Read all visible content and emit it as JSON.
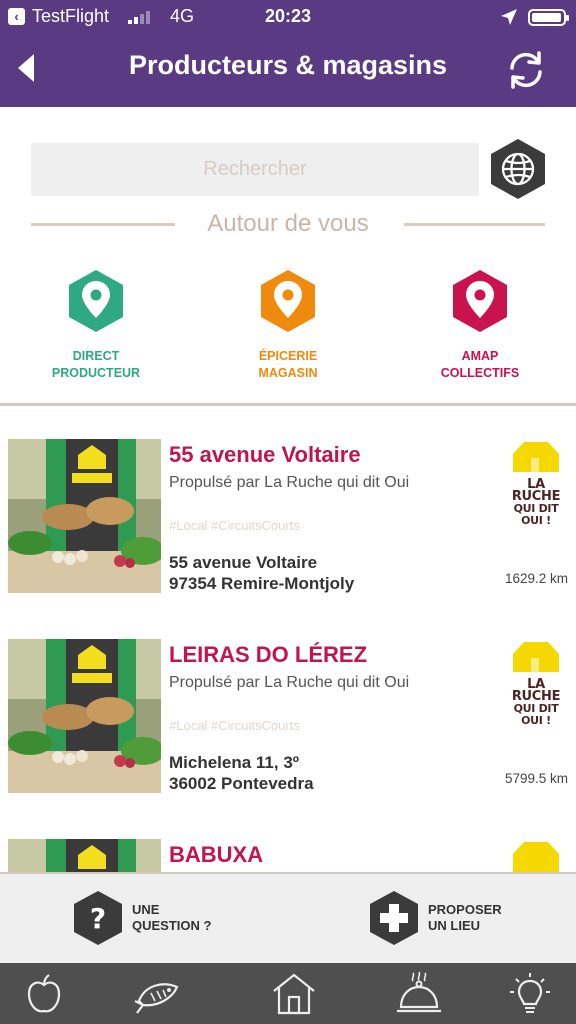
{
  "status_bar": {
    "back_app": "TestFlight",
    "network": "4G",
    "time": "20:23"
  },
  "header": {
    "title": "Producteurs & magasins"
  },
  "search": {
    "placeholder": "Rechercher"
  },
  "section": {
    "nearby_label": "Autour de vous"
  },
  "categories": [
    {
      "line1": "DIRECT",
      "line2": "PRODUCTEUR",
      "color": "#2fa884"
    },
    {
      "line1": "ÉPICERIE",
      "line2": "MAGASIN",
      "color": "#ef8a0c"
    },
    {
      "line1": "AMAP",
      "line2": "COLLECTIFS",
      "color": "#c9124e"
    }
  ],
  "results": [
    {
      "title": "55 avenue Voltaire",
      "powered_by": "Propulsé par La Ruche qui dit Oui",
      "tags": "#Local #CircuitsCourts",
      "address_line1": "55 avenue Voltaire",
      "address_line2": "97354 Remire-Montjoly",
      "distance": "1629.2 km",
      "logo_line1": "LA RUCHE",
      "logo_line2": "QUI DIT OUI !"
    },
    {
      "title": "LEIRAS DO LÉREZ",
      "powered_by": "Propulsé par La Ruche qui dit Oui",
      "tags": "#Local #CircuitsCourts",
      "address_line1": "Michelena 11, 3º",
      "address_line2": "36002 Pontevedra",
      "distance": "5799.5 km",
      "logo_line1": "LA RUCHE",
      "logo_line2": "QUI DIT OUI !"
    },
    {
      "title": "BABUXA",
      "powered_by": "",
      "tags": "",
      "address_line1": "",
      "address_line2": "",
      "distance": "",
      "logo_line1": "",
      "logo_line2": ""
    }
  ],
  "actions": {
    "question_line1": "UNE",
    "question_line2": "QUESTION ?",
    "propose_line1": "PROPOSER",
    "propose_line2": "UN LIEU"
  },
  "tabbar": {
    "icons": [
      "apple-icon",
      "fish-icon",
      "home-icon",
      "cloche-icon",
      "lightbulb-icon"
    ]
  },
  "colors": {
    "header_bg": "#5a3a82",
    "title_accent": "#c0154f",
    "divider": "#d4c8bd",
    "tabbar_bg": "#4f4f4f"
  }
}
